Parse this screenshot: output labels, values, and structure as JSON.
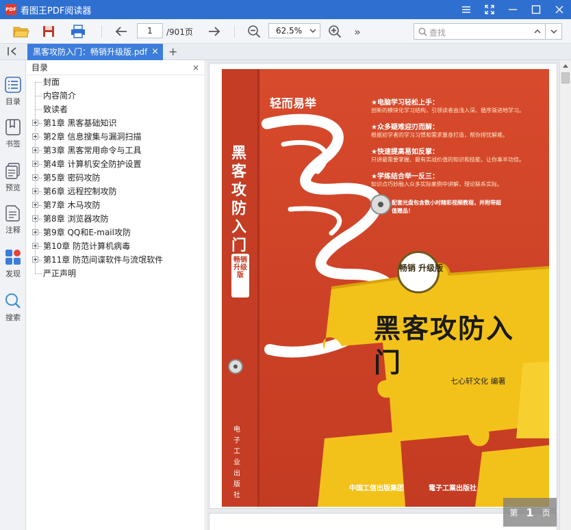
{
  "window": {
    "app_icon_text": "PDF",
    "title": "看图王PDF阅读器"
  },
  "toolbar": {
    "page_current": "1",
    "page_total": "/901页",
    "zoom": "62.5%",
    "search_placeholder": "查找",
    "more": "»"
  },
  "tabs": [
    {
      "label": "黑客攻防入门：畅销升级版.pdf",
      "close": "×"
    }
  ],
  "tab_add": "+",
  "rail": [
    {
      "label": "目录",
      "icon": "outline-icon"
    },
    {
      "label": "书签",
      "icon": "bookmark-icon"
    },
    {
      "label": "预览",
      "icon": "thumbnail-icon"
    },
    {
      "label": "注释",
      "icon": "annotation-icon"
    },
    {
      "label": "发现",
      "icon": "discover-icon"
    },
    {
      "label": "搜索",
      "icon": "search-icon"
    }
  ],
  "outline": {
    "title": "目录",
    "close": "×",
    "items": [
      {
        "label": "封面",
        "expandable": false
      },
      {
        "label": "内容简介",
        "expandable": false
      },
      {
        "label": "致读者",
        "expandable": false
      },
      {
        "label": "第1章 黑客基础知识",
        "expandable": true
      },
      {
        "label": "第2章 信息搜集与漏洞扫描",
        "expandable": true
      },
      {
        "label": "第3章 黑客常用命令与工具",
        "expandable": true
      },
      {
        "label": "第4章 计算机安全防护设置",
        "expandable": true
      },
      {
        "label": "第5章 密码攻防",
        "expandable": true
      },
      {
        "label": "第6章 远程控制攻防",
        "expandable": true
      },
      {
        "label": "第7章 木马攻防",
        "expandable": true
      },
      {
        "label": "第8章 浏览器攻防",
        "expandable": true
      },
      {
        "label": "第9章 QQ和E-mail攻防",
        "expandable": true
      },
      {
        "label": "第10章 防范计算机病毒",
        "expandable": true
      },
      {
        "label": "第11章 防范间谍软件与流氓软件",
        "expandable": true
      },
      {
        "label": "严正声明",
        "expandable": false
      }
    ]
  },
  "page_indicator": {
    "prefix": "第",
    "number": "1",
    "suffix": "页"
  },
  "cover": {
    "series": "轻而易举",
    "spine_title": "黑客攻防入门",
    "spine_badge": "畅销升级版",
    "features": [
      {
        "heading": "★电脑学习轻松上手：",
        "desc": "创新的模块化学习结构，引领读者由浅入深、循序渐进地学习。"
      },
      {
        "heading": "★众多疑难迎刃而解：",
        "desc": "根据初学者的学习习惯和需求量身打造，帮你排忧解难。"
      },
      {
        "heading": "★快速提高易如反掌：",
        "desc": "只讲最需要掌握、最有实战价值的知识和技能，让你事半功倍。"
      },
      {
        "heading": "★学练结合举一反三：",
        "desc": "知识点巧妙融入众多实际案例中讲解，理论联系实际。"
      }
    ],
    "cd_note": "配套光盘包含数小时精彩视频教程，并附带超值赠品！",
    "circle_badge": "畅销 升级版",
    "main_title": "黑客攻防入门",
    "author": "七心轩文化 编著",
    "publisher1": "中国工信出版集团",
    "publisher2": "電子工業出版社",
    "spine_publisher": "电子工业出版社"
  },
  "colors": {
    "titlebar": "#2f6fd0",
    "tab_active": "#3c7ddb",
    "cover_red": "#d6452a",
    "cover_yellow": "#f3c21a"
  }
}
